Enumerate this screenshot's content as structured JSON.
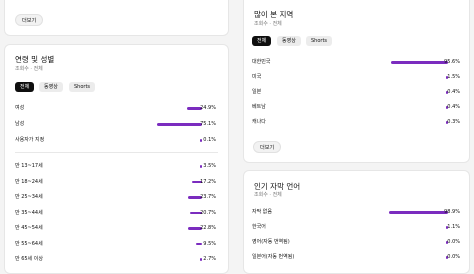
{
  "top_more_button": "더보기",
  "age_gender": {
    "title": "연령 및 성별",
    "subtitle": "조회수 · 전체",
    "chips": [
      "전체",
      "동영상",
      "Shorts"
    ],
    "gender_rows": [
      {
        "label": "여성",
        "value": 24.9,
        "pct": "24.9%"
      },
      {
        "label": "남성",
        "value": 75.1,
        "pct": "75.1%"
      },
      {
        "label": "사용자가 지정",
        "value": 0.1,
        "pct": "0.1%"
      }
    ],
    "age_rows": [
      {
        "label": "만 13~17세",
        "value": 3.5,
        "pct": "3.5%"
      },
      {
        "label": "만 18~24세",
        "value": 17.2,
        "pct": "17.2%"
      },
      {
        "label": "만 25~34세",
        "value": 23.7,
        "pct": "23.7%"
      },
      {
        "label": "만 35~44세",
        "value": 20.7,
        "pct": "20.7%"
      },
      {
        "label": "만 45~54세",
        "value": 22.8,
        "pct": "22.8%"
      },
      {
        "label": "만 55~64세",
        "value": 9.5,
        "pct": "9.5%"
      },
      {
        "label": "만 65세 이상",
        "value": 2.7,
        "pct": "2.7%"
      }
    ]
  },
  "regions": {
    "title": "많이 본 지역",
    "subtitle": "조회수 · 전체",
    "chips": [
      "전체",
      "동영상",
      "Shorts"
    ],
    "rows": [
      {
        "label": "대한민국",
        "value": 95.6,
        "pct": "95.6%"
      },
      {
        "label": "미국",
        "value": 1.5,
        "pct": "1.5%"
      },
      {
        "label": "일본",
        "value": 0.4,
        "pct": "0.4%"
      },
      {
        "label": "베트남",
        "value": 0.4,
        "pct": "0.4%"
      },
      {
        "label": "캐나다",
        "value": 0.3,
        "pct": "0.3%"
      }
    ],
    "more_button": "더보기"
  },
  "subtitle_langs": {
    "title": "인기 자막 언어",
    "subtitle": "조회수 · 전체",
    "rows": [
      {
        "label": "자막 없음",
        "value": 98.9,
        "pct": "98.9%"
      },
      {
        "label": "한국어",
        "value": 1.1,
        "pct": "1.1%"
      },
      {
        "label": "영어(자동 번역됨)",
        "value": 0.0,
        "pct": "0.0%"
      },
      {
        "label": "일본어(자동 번역됨)",
        "value": 0.0,
        "pct": "0.0%"
      }
    ]
  },
  "colors": {
    "bar": "#7b2cbf"
  }
}
